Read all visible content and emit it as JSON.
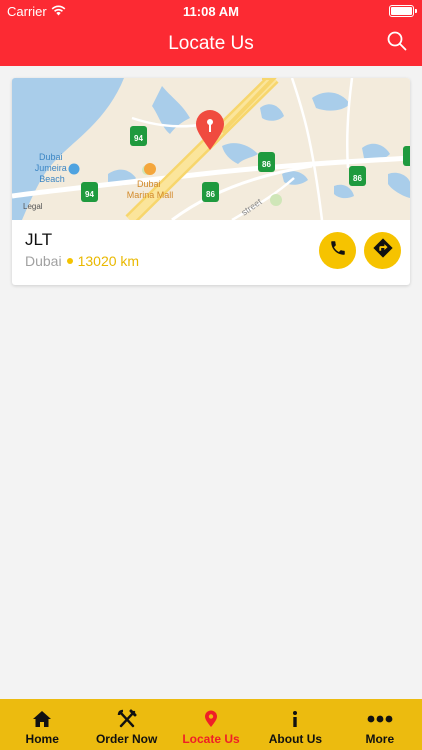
{
  "status_bar": {
    "carrier": "Carrier",
    "time": "11:08 AM"
  },
  "header": {
    "title": "Locate Us",
    "icon": "search-icon"
  },
  "map": {
    "labels": {
      "jumeira_beach": [
        "Dubai",
        "Jumeira",
        "Beach"
      ],
      "marina_mall": [
        "Dubai",
        "Marina Mall"
      ],
      "street": "street",
      "legal": "Legal"
    },
    "route_shields": [
      "94",
      "94",
      "86",
      "86",
      "86"
    ]
  },
  "store": {
    "name": "JLT",
    "city": "Dubai",
    "distance": "13020 km"
  },
  "tabs": [
    {
      "label": "Home",
      "icon": "home-icon",
      "active": false
    },
    {
      "label": "Order Now",
      "icon": "fork-knife-icon",
      "active": false
    },
    {
      "label": "Locate Us",
      "icon": "location-pin-icon",
      "active": true
    },
    {
      "label": "About Us",
      "icon": "info-icon",
      "active": false
    },
    {
      "label": "More",
      "icon": "more-dots-icon",
      "active": false
    }
  ],
  "colors": {
    "header": "#fc2a33",
    "accent_yellow": "#f6c300",
    "tabbar": "#ecbb0f",
    "active_tab": "#ef1f27"
  }
}
